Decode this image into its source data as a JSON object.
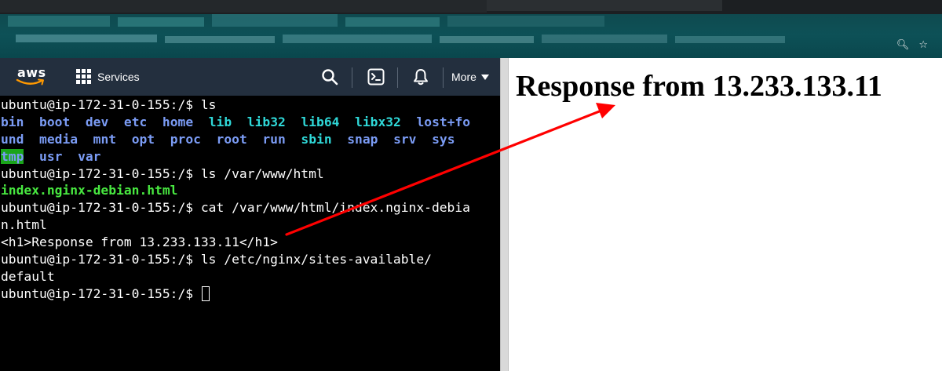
{
  "aws": {
    "logo_text": "aws",
    "services_label": "Services",
    "more_label": "More"
  },
  "terminal": {
    "prompt": "ubuntu@ip-172-31-0-155:/$",
    "cmd1": "ls",
    "ls_row1": [
      "bin",
      "boot",
      "dev",
      "etc",
      "home",
      "lib",
      "lib32",
      "lib64",
      "libx32",
      "lost+fo"
    ],
    "ls_row2": [
      "und",
      "media",
      "mnt",
      "opt",
      "proc",
      "root",
      "run",
      "sbin",
      "snap",
      "srv",
      "sys"
    ],
    "ls_row3": [
      "tmp",
      "usr",
      "var"
    ],
    "cmd2": "ls /var/www/html",
    "out2": "index.nginx-debian.html",
    "cmd3_part1": "cat /var/www/html/index.nginx-debia",
    "cmd3_part2": "n.html",
    "out3": "<h1>Response from 13.233.133.11</h1>",
    "cmd4": "ls /etc/nginx/sites-available/",
    "out4": "default"
  },
  "browser": {
    "heading": "Response from 13.233.133.11"
  },
  "colors": {
    "aws_nav": "#232f3e",
    "terminal_bg": "#000000",
    "dir_blue": "#7b9cf5",
    "cyan": "#2fd8d8",
    "file_green": "#48e840",
    "tmp_highlight": "#1aa41a",
    "arrow_red": "#ff0000"
  },
  "icons": [
    "search-icon",
    "cloudshell-icon",
    "bell-icon",
    "zoom-icon",
    "star-icon",
    "grid-icon"
  ]
}
